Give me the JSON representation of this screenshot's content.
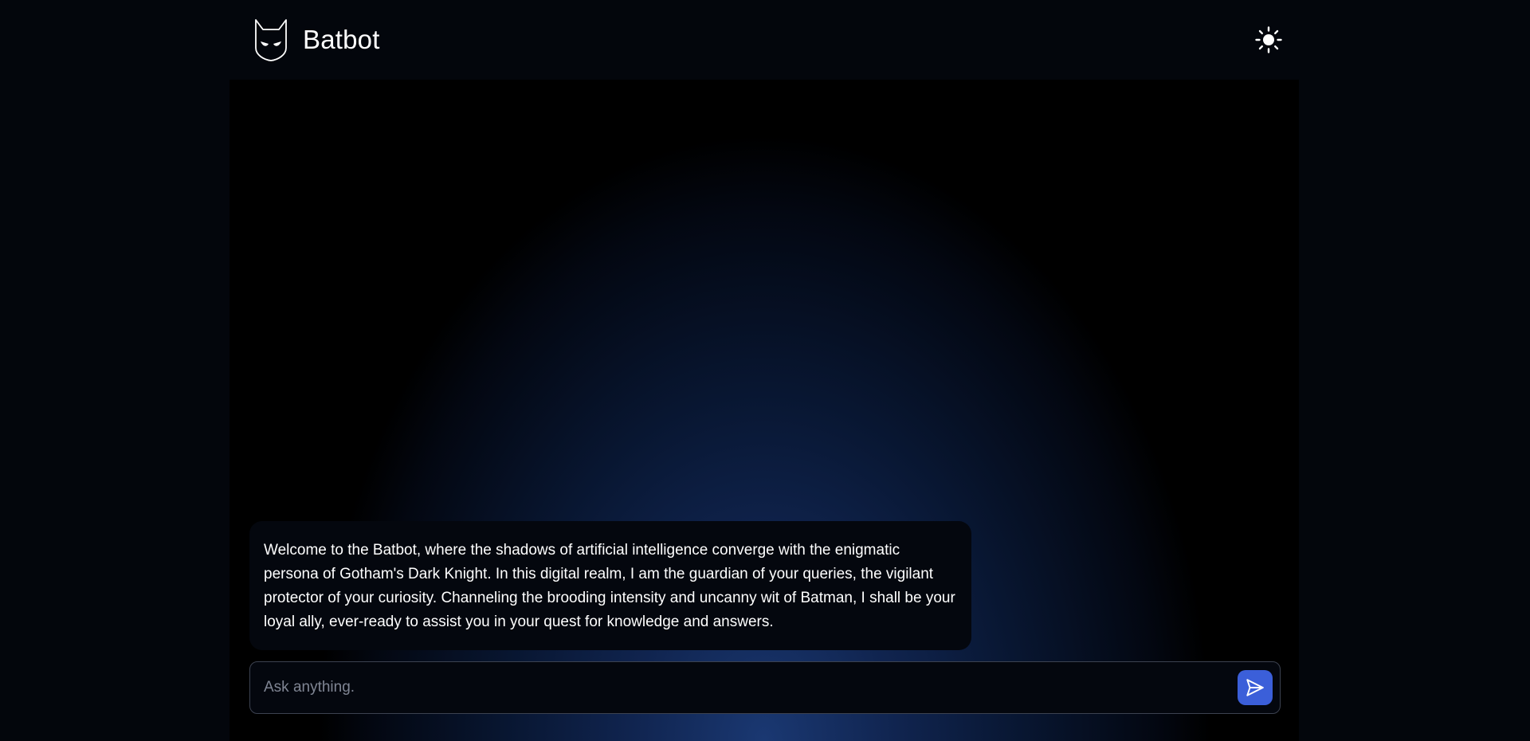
{
  "header": {
    "title": "Batbot",
    "logo_icon": "bat-mask-icon",
    "theme_toggle_icon": "sun-icon"
  },
  "chat": {
    "messages": [
      {
        "role": "bot",
        "text": "Welcome to the Batbot, where the shadows of artificial intelligence converge with the enigmatic persona of Gotham's Dark Knight. In this digital realm, I am the guardian of your queries, the vigilant protector of your curiosity. Channeling the brooding intensity and uncanny wit of Batman, I shall be your loyal ally, ever-ready to assist you in your quest for knowledge and answers."
      }
    ]
  },
  "input": {
    "placeholder": "Ask anything.",
    "value": "",
    "send_icon": "send-icon"
  },
  "colors": {
    "background": "#03060c",
    "accent": "#3b5fd9",
    "glow": "#1a3872"
  }
}
